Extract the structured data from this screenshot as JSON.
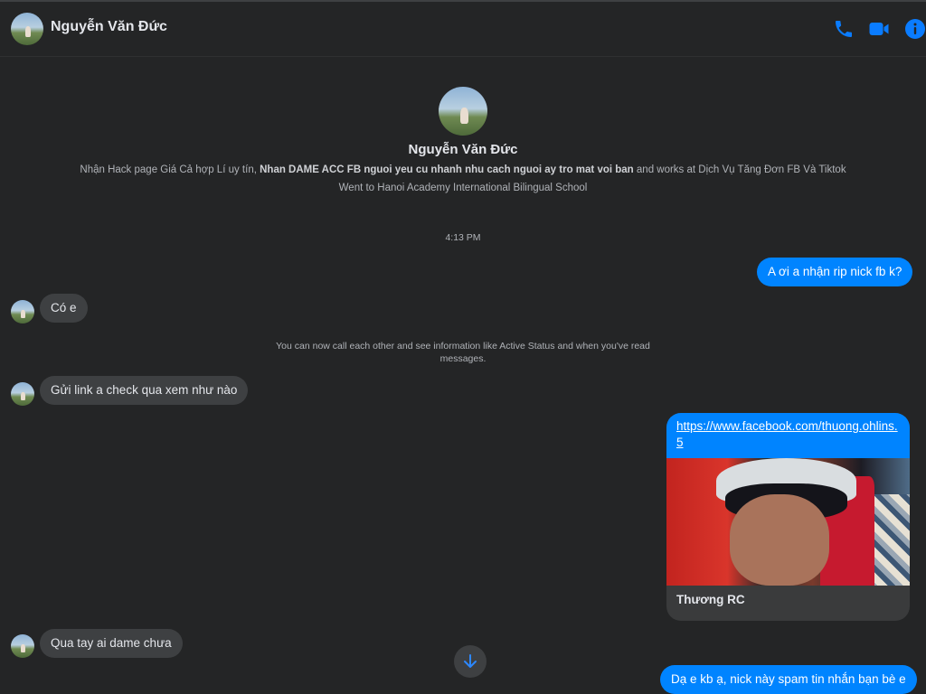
{
  "contact": {
    "name": "Nguyễn Văn Đức"
  },
  "profile": {
    "name": "Nguyễn Văn Đức",
    "bio_prefix": "Nhận Hack page Giá Cả hợp Lí uy tín, ",
    "bio_bold": "Nhan DAME ACC FB nguoi yeu cu nhanh nhu cach nguoi ay tro mat voi ban",
    "bio_suffix": " and works at Dịch Vụ Tăng Đơn FB Và Tiktok",
    "education": "Went to Hanoi Academy International Bilingual School"
  },
  "timestamp": "4:13 PM",
  "notice": "You can now call each other and see information like Active Status and when you've read messages.",
  "messages": {
    "m1": "A ơi a nhận rip nick fb k?",
    "m2": "Có e",
    "m3": "Gửi link a check qua xem như nào",
    "m5": "Qua tay ai dame chưa",
    "m6": "Dạ e kb ạ, nick này spam tin nhắn bạn bè e"
  },
  "link_card": {
    "url": "https://www.facebook.com/thuong.ohlins.5",
    "title": "Thương RC"
  },
  "icons": {
    "phone": "phone-icon",
    "video": "video-camera-icon",
    "info": "info-icon",
    "scroll_down": "arrow-down-icon"
  },
  "colors": {
    "background": "#242526",
    "accent": "#0084ff",
    "incoming_bubble": "#3e4042",
    "text": "#e4e6eb",
    "muted_text": "#b0b3b8"
  }
}
